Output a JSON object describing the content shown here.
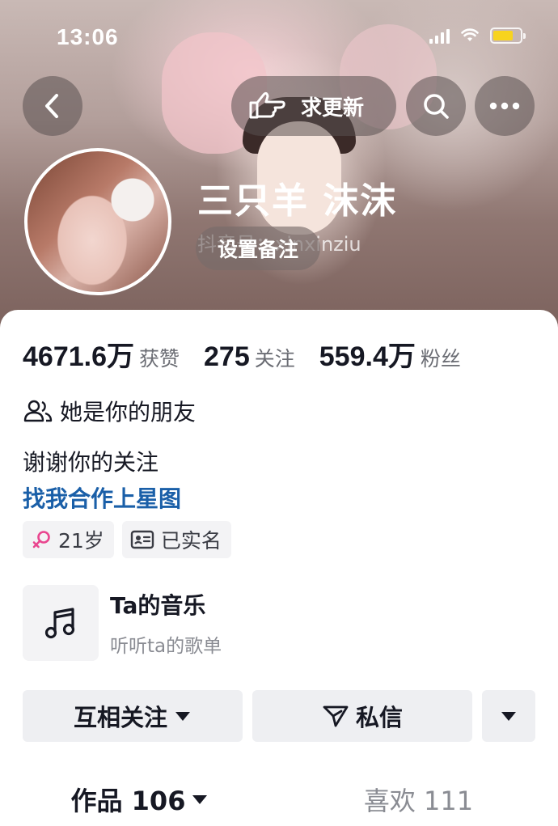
{
  "status_bar": {
    "time": "13:06"
  },
  "header": {
    "urge_update_label": "求更新",
    "nickname": "三只羊 沫沫",
    "douyin_id_text": "抖音号：xinxinziu",
    "remark_label": "设置备注"
  },
  "stats": [
    {
      "value": "4671.6万",
      "label": "获赞"
    },
    {
      "value": "275",
      "label": "关注"
    },
    {
      "value": "559.4万",
      "label": "粉丝"
    }
  ],
  "profile": {
    "friend_text": "她是你的朋友",
    "signature": "谢谢你的关注",
    "business_link": "找我合作上星图",
    "tags": {
      "age": "21岁",
      "verified": "已实名"
    }
  },
  "music": {
    "title": "Ta的音乐",
    "subtitle": "听听ta的歌单"
  },
  "actions": {
    "follow_label": "互相关注",
    "message_label": "私信"
  },
  "tabs": [
    {
      "label": "作品 106",
      "active": true
    },
    {
      "label": "喜欢 111",
      "active": false
    }
  ],
  "colors": {
    "accent_link": "#1a5fa8",
    "battery": "#f7d31e",
    "female_icon": "#e9468f"
  }
}
